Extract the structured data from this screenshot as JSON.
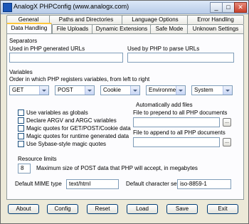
{
  "window": {
    "title": "AnalogX PHPConfig (www.analogx.com)",
    "minimize": "_",
    "maximize": "□",
    "close": "✕"
  },
  "tabs_row1": [
    "General",
    "Paths and Directories",
    "Language Options",
    "Error Handling"
  ],
  "tabs_row2": [
    "Data Handling",
    "File Uploads",
    "Dynamic Extensions",
    "Safe Mode",
    "Unknown Settings"
  ],
  "separators": {
    "heading": "Separators",
    "generated_label": "Used in PHP generated URLs",
    "generated_value": "",
    "parse_label": "Used by PHP to parse URLs",
    "parse_value": ""
  },
  "variables": {
    "heading": "Variables",
    "order_label": "Order in which PHP registers variables, from left to right",
    "order": [
      "GET",
      "POST",
      "Cookie",
      "Environment",
      "System"
    ]
  },
  "options": [
    {
      "label": "Use variables as globals",
      "checked": false
    },
    {
      "label": "Declare ARGV and ARGC variables",
      "checked": false
    },
    {
      "label": "Magic quotes for GET/POST/Cookie data",
      "checked": false
    },
    {
      "label": "Magic quotes for runtime generated data",
      "checked": false
    },
    {
      "label": "Use Sybase-style magic quotes",
      "checked": false
    }
  ],
  "auto_files": {
    "heading": "Automatically add files",
    "prepend_label": "File to prepend to all PHP documents",
    "prepend_value": "",
    "append_label": "File to append to all PHP documents",
    "append_value": "",
    "browse": "..."
  },
  "resource": {
    "heading": "Resource limits",
    "post_max_value": "8",
    "post_max_label": "Maximum size of POST data that PHP will accept, in megabytes"
  },
  "mime": {
    "label": "Default MIME type",
    "value": "text/html"
  },
  "charset": {
    "label": "Default character set",
    "value": "iso-8859-1"
  },
  "buttons": [
    "About",
    "Config",
    "Reset",
    "Load",
    "Save",
    "Exit"
  ]
}
